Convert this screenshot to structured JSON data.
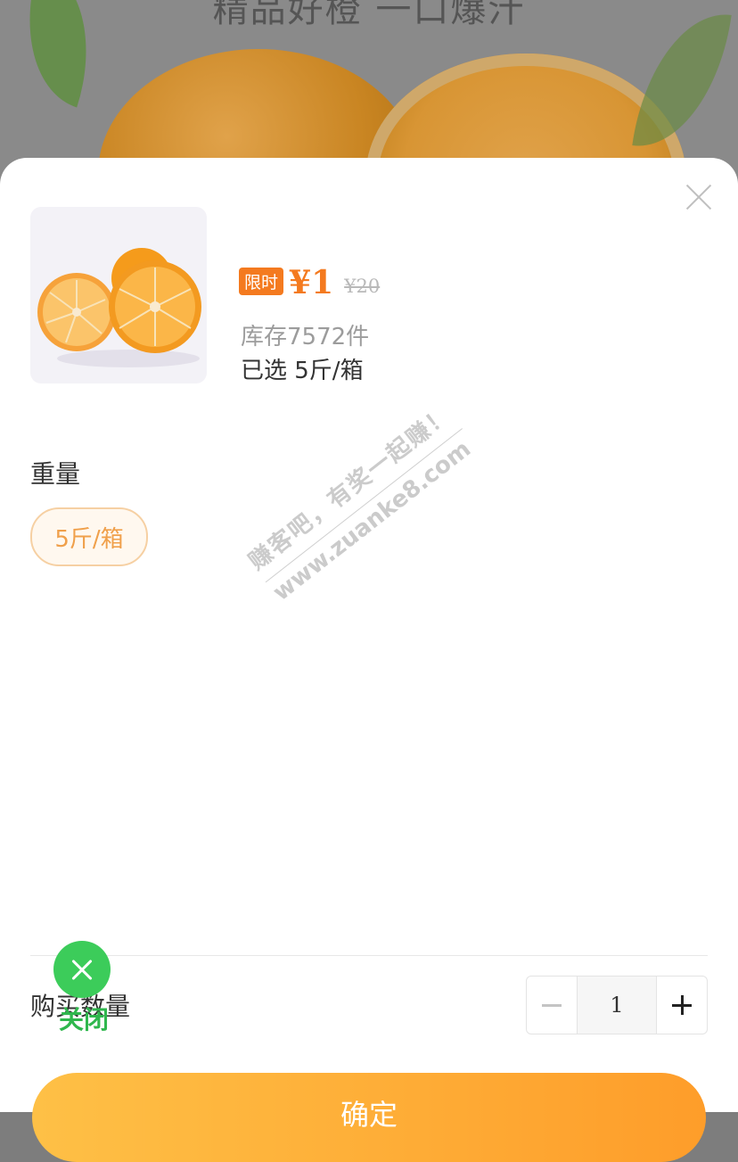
{
  "background": {
    "banner_text": "精品好橙 一口爆汁"
  },
  "product": {
    "badge": "限时",
    "price": "¥1",
    "original_price": "¥20",
    "stock_text": "库存7572件",
    "selected_text": "已选 5斤/箱"
  },
  "spec": {
    "label": "重量",
    "options": [
      "5斤/箱"
    ]
  },
  "watermark": {
    "line1": "赚客吧，有奖一起赚！",
    "line2": "www.zuanke8.com"
  },
  "quantity": {
    "label": "购买数量",
    "value": "1"
  },
  "confirm": {
    "label": "确定"
  },
  "floating_close": {
    "label": "关闭"
  },
  "colors": {
    "accent": "#f47a1f",
    "button_start": "#fec046",
    "button_end": "#fe9d2a",
    "close_bubble": "#3ccc5a"
  }
}
